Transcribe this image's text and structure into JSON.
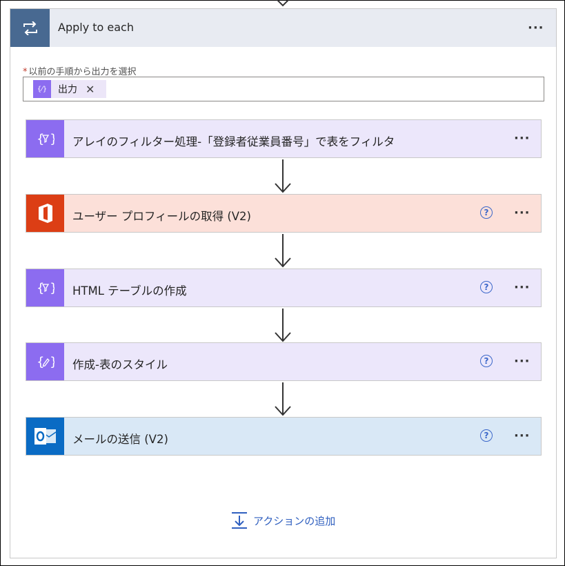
{
  "loop": {
    "title": "Apply to each",
    "more_label": "···"
  },
  "select_output": {
    "required_mark": "*",
    "label": "以前の手順から出力を選択",
    "token_icon_glyph": "{⁄}",
    "token_label": "出力",
    "token_remove": "✕"
  },
  "steps": [
    {
      "title": "アレイのフィルター処理-「登録者従業員番号」で表をフィルタ",
      "icon": "filter-icon",
      "bg": "#ece7fb",
      "icon_bg": "#8c6cf0",
      "help": false
    },
    {
      "title": "ユーザー プロフィールの取得 (V2)",
      "icon": "office-icon",
      "bg": "#fce0d9",
      "icon_bg": "#dc3e15",
      "help": true
    },
    {
      "title": "HTML テーブルの作成",
      "icon": "filter-icon",
      "bg": "#ece7fb",
      "icon_bg": "#8c6cf0",
      "help": true
    },
    {
      "title": "作成-表のスタイル",
      "icon": "compose-icon",
      "bg": "#ece7fb",
      "icon_bg": "#8c6cf0",
      "help": true
    },
    {
      "title": "メールの送信 (V2)",
      "icon": "outlook-icon",
      "bg": "#d9e8f6",
      "icon_bg": "#0a6bc4",
      "help": true
    }
  ],
  "help_glyph": "?",
  "more_glyph": "···",
  "add_action_label": "アクションの追加"
}
